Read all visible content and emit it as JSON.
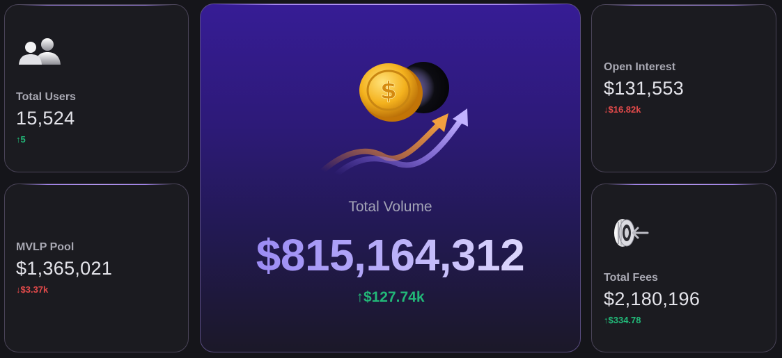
{
  "cards": {
    "total_users": {
      "label": "Total Users",
      "value": "15,524",
      "delta": "↑5",
      "delta_direction": "up",
      "icon": "users-icon"
    },
    "mvlp_pool": {
      "label": "MVLP Pool",
      "value": "$1,365,021",
      "delta": "↓$3.37k",
      "delta_direction": "down"
    },
    "total_volume": {
      "label": "Total Volume",
      "value": "$815,164,312",
      "delta": "↑$127.74k",
      "delta_direction": "up",
      "icon": "coin-growth-icon"
    },
    "open_interest": {
      "label": "Open Interest",
      "value": "$131,553",
      "delta": "↓$16.82k",
      "delta_direction": "down"
    },
    "total_fees": {
      "label": "Total Fees",
      "value": "$2,180,196",
      "delta": "↑$334.78",
      "delta_direction": "up",
      "icon": "coin-stack-arrow-icon"
    }
  },
  "colors": {
    "background": "#15151a",
    "card": "#1b1b20",
    "border_accent": "#a586f0",
    "up": "#22b878",
    "down": "#e24a4a",
    "volume_gradient_top": "#361c95"
  }
}
